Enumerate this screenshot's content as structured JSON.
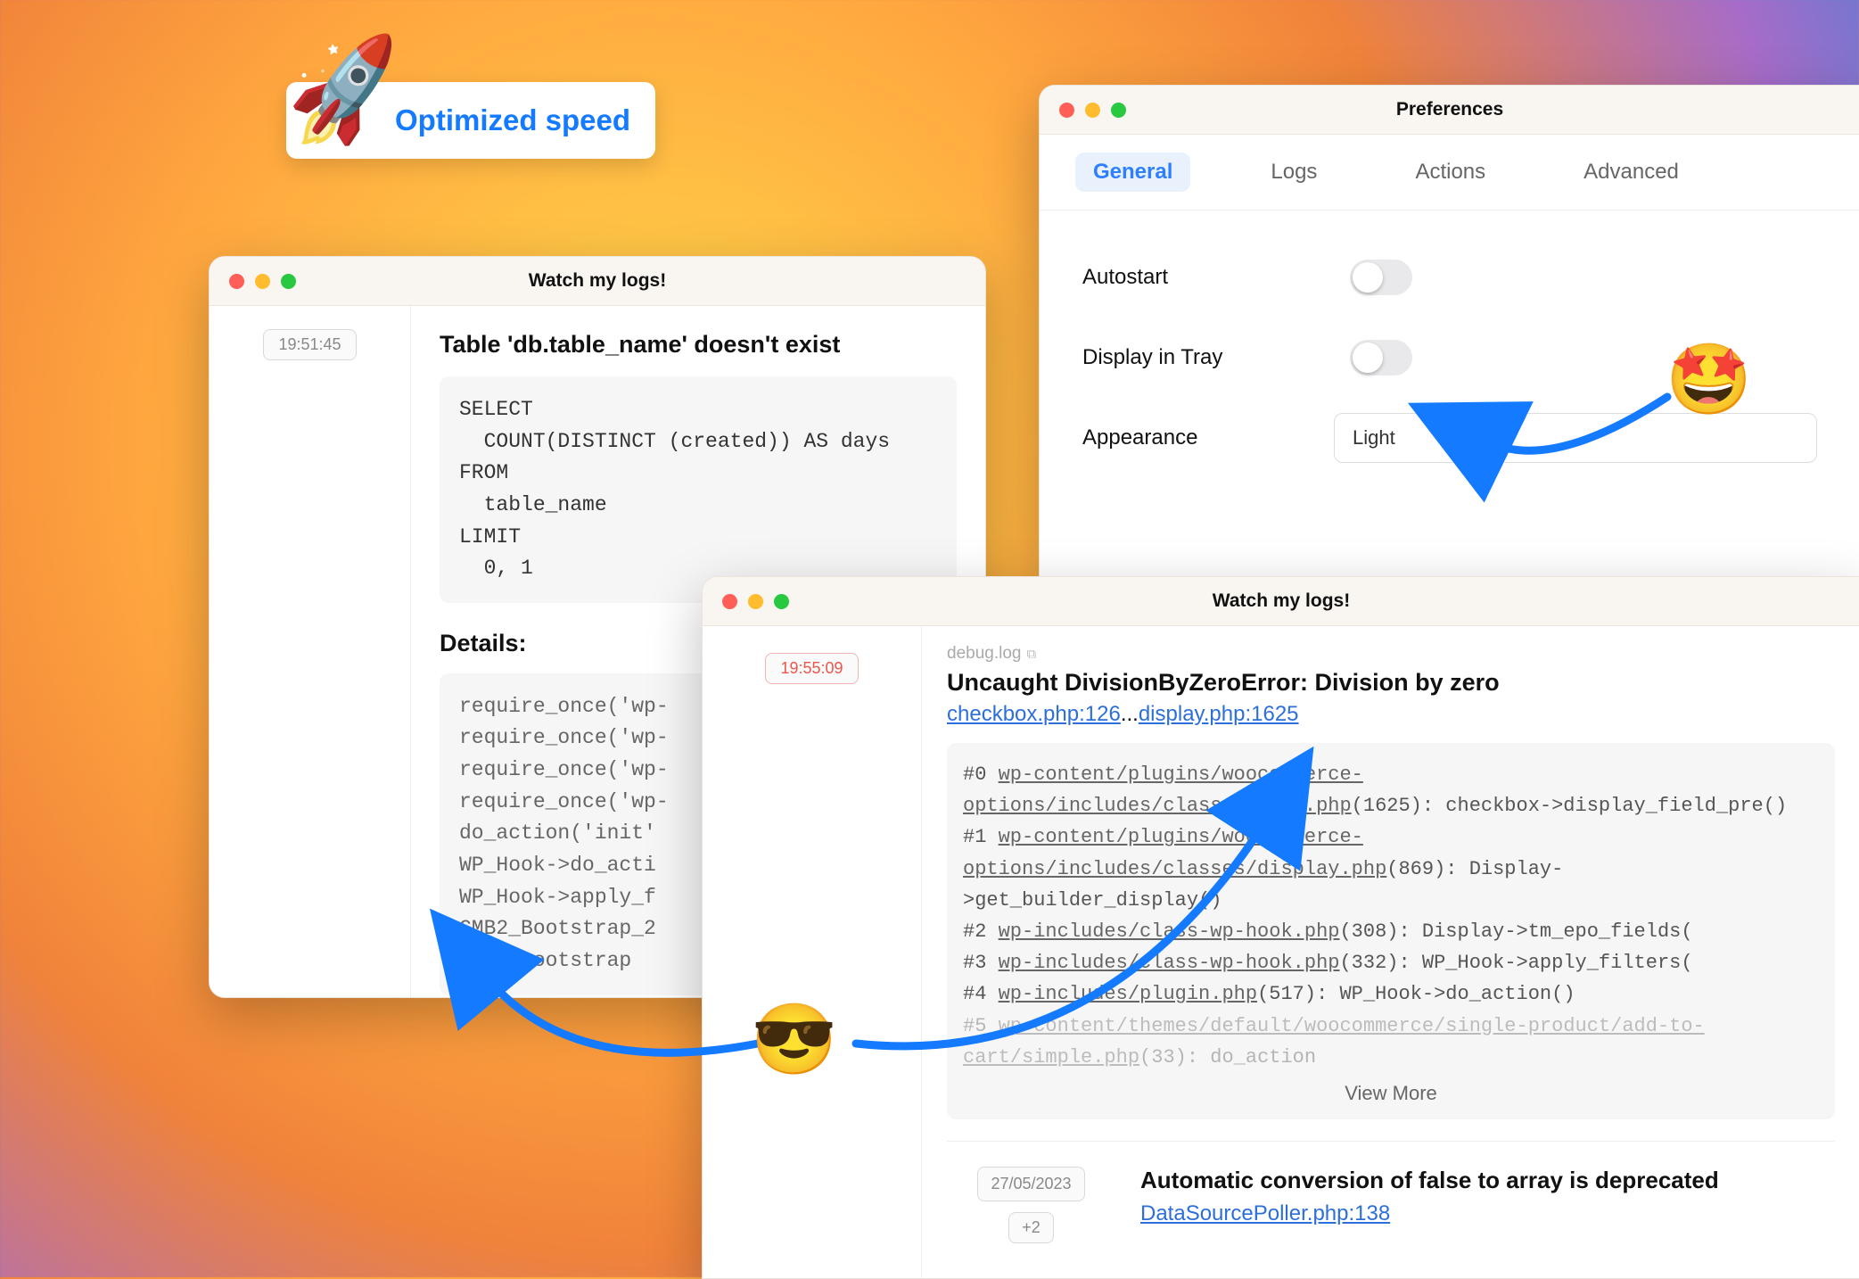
{
  "badge": {
    "label": "Optimized speed"
  },
  "window1": {
    "title": "Watch my logs!",
    "timestamp": "19:51:45",
    "error_title": "Table 'db.table_name' doesn't exist",
    "sql": "SELECT\n  COUNT(DISTINCT (created)) AS days\nFROM\n  table_name\nLIMIT\n  0, 1",
    "details_label": "Details:",
    "details_code": "require_once('wp-\nrequire_once('wp-\nrequire_once('wp-\nrequire_once('wp-\ndo_action('init'\nWP_Hook->do_acti\nWP_Hook->apply_f\nCMB2_Bootstrap_2\ncmb2_bootstrap"
  },
  "preferences": {
    "title": "Preferences",
    "tabs": [
      "General",
      "Logs",
      "Actions",
      "Advanced"
    ],
    "active_tab": 0,
    "rows": {
      "autostart": "Autostart",
      "display_tray": "Display in Tray",
      "appearance_label": "Appearance",
      "appearance_value": "Light"
    }
  },
  "window3": {
    "title": "Watch my logs!",
    "timestamp": "19:55:09",
    "file": "debug.log",
    "error_title": "Uncaught DivisionByZeroError: Division by zero",
    "link1": "checkbox.php:126",
    "link_sep": "...",
    "link2": "display.php:1625",
    "trace": {
      "l0_pre": "#0 ",
      "l0_u": "wp-content/plugins/woocommerce-options/includes/classes/dlay.php",
      "l0_post": "(1625): checkbox->display_field_pre()",
      "l1_pre": "#1 ",
      "l1_u": "wp-content/plugins/woocommerce-options/includes/classes/display.php",
      "l1_post": "(869): Display->get_builder_display()",
      "l2_pre": "#2 ",
      "l2_u": "wp-includes/class-wp-hook.php",
      "l2_post": "(308): Display->tm_epo_fields(",
      "l3_pre": "#3 ",
      "l3_u": "wp-includes/class-wp-hook.php",
      "l3_post": "(332): WP_Hook->apply_filters(",
      "l4_pre": "#4 ",
      "l4_u": "wp-includes/plugin.php",
      "l4_post": "(517): WP_Hook->do_action()",
      "l5_pre": "#5 ",
      "l5_u": "wp-content/themes/default/woocommerce/single-product/add-to-cart/simple.php",
      "l5_post": "(33): do_action"
    },
    "view_more": "View More",
    "entry2": {
      "date": "27/05/2023",
      "plus": "+2",
      "title": "Automatic conversion of false to array is deprecated",
      "link": "DataSourcePoller.php:138"
    }
  }
}
